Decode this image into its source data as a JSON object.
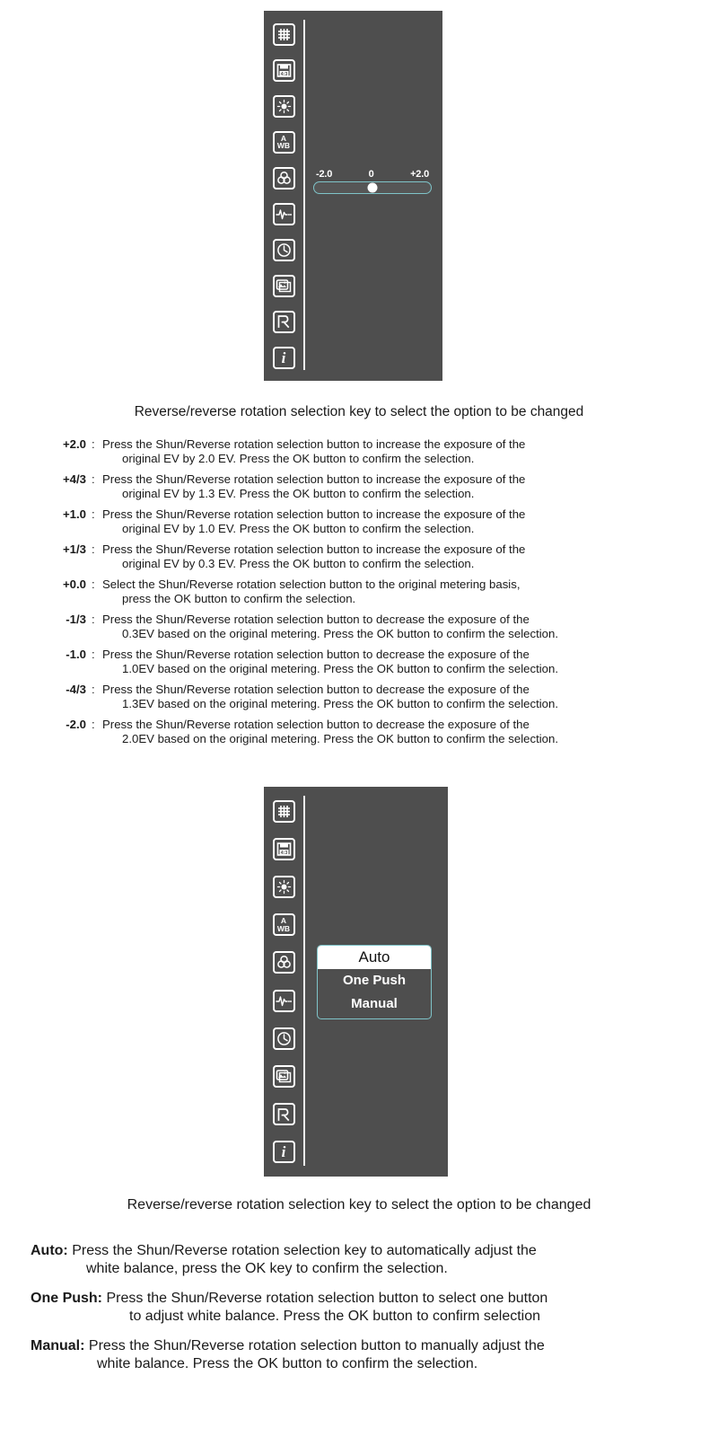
{
  "panel_one": {
    "icons": [
      {
        "name": "grid-icon",
        "label": "grid"
      },
      {
        "name": "aspect-ratio-icon",
        "label": "4:3"
      },
      {
        "name": "brightness-icon",
        "label": "brightness"
      },
      {
        "name": "auto-white-balance-icon",
        "label_top": "A",
        "label_bottom": "WB"
      },
      {
        "name": "color-wheel-icon",
        "label": "color"
      },
      {
        "name": "waveform-icon",
        "label": "waveform"
      },
      {
        "name": "clock-icon",
        "label": "clock"
      },
      {
        "name": "image-stack-icon",
        "label": "image"
      },
      {
        "name": "reset-icon",
        "label": "R"
      },
      {
        "name": "info-icon",
        "label": "i"
      }
    ],
    "slider": {
      "tick_min": "-2.0",
      "tick_mid": "0",
      "tick_max": "+2.0",
      "value": "0",
      "accent_color": "#7fc4c9",
      "knob_color": "#ffffff"
    },
    "panel_bg": "#4e4e4e"
  },
  "panel_two": {
    "icons": [
      {
        "name": "grid-icon",
        "label": "grid"
      },
      {
        "name": "aspect-ratio-icon",
        "label": "4:3"
      },
      {
        "name": "brightness-icon",
        "label": "brightness"
      },
      {
        "name": "auto-white-balance-icon",
        "label_top": "A",
        "label_bottom": "WB"
      },
      {
        "name": "color-wheel-icon",
        "label": "color"
      },
      {
        "name": "waveform-icon",
        "label": "waveform"
      },
      {
        "name": "clock-icon",
        "label": "clock"
      },
      {
        "name": "image-stack-icon",
        "label": "image"
      },
      {
        "name": "reset-icon",
        "label": "R"
      },
      {
        "name": "info-icon",
        "label": "i"
      }
    ],
    "white_balance_menu": {
      "options": [
        "Auto",
        "One Push",
        "Manual"
      ],
      "selected": "Auto",
      "accent_color": "#7fc4c9"
    },
    "panel_bg": "#4e4e4e"
  },
  "caption_one": "Reverse/reverse rotation selection key to select the option to be changed",
  "caption_two": "Reverse/reverse rotation selection key to select the option to be changed",
  "exposure_entries": [
    {
      "key": "+2.0",
      "line1": "Press the Shun/Reverse rotation selection button to increase the exposure of the",
      "line2": "original EV by 2.0 EV. Press the OK button to confirm the selection."
    },
    {
      "key": "+4/3",
      "line1": "Press the Shun/Reverse rotation selection button to increase the exposure of the",
      "line2": "original EV by 1.3 EV. Press the OK button to confirm the selection."
    },
    {
      "key": "+1.0",
      "line1": "Press the Shun/Reverse rotation selection button to increase the exposure of the",
      "line2": "original EV by 1.0 EV. Press the OK button to confirm the selection."
    },
    {
      "key": "+1/3",
      "line1": "Press the Shun/Reverse rotation selection button to increase the exposure of the",
      "line2": "original EV by 0.3 EV. Press the OK button to confirm the selection."
    },
    {
      "key": "+0.0",
      "line1": "Select the Shun/Reverse rotation selection button to the original metering basis,",
      "line2": "press the OK button to confirm the selection."
    },
    {
      "key": "-1/3",
      "line1": "Press the Shun/Reverse rotation selection button to decrease the exposure of the",
      "line2": "0.3EV based on the original metering. Press the OK button to confirm the selection."
    },
    {
      "key": "-1.0",
      "line1": "Press the Shun/Reverse rotation selection button to decrease the exposure of the",
      "line2": "1.0EV based on the original metering. Press the OK button to confirm the selection."
    },
    {
      "key": "-4/3",
      "line1": "Press the Shun/Reverse rotation selection button to decrease the exposure of the",
      "line2": "1.3EV based on the original metering. Press the OK button to confirm the selection."
    },
    {
      "key": "-2.0",
      "line1": "Press the Shun/Reverse rotation selection button to decrease the exposure of the",
      "line2": "2.0EV based on the original metering. Press the OK button to confirm the selection."
    }
  ],
  "separator_colon": ":",
  "white_balance_entries": [
    {
      "term": "Auto:",
      "line1": "Press the Shun/Reverse rotation selection key to automatically adjust the",
      "line2": "white balance, press the OK key to confirm the selection."
    },
    {
      "term": "One Push:",
      "line1": "Press the Shun/Reverse rotation selection button to select one button",
      "line2": "to adjust white balance. Press the OK button to confirm selection"
    },
    {
      "term": "Manual:",
      "line1": "Press the Shun/Reverse rotation selection button to manually adjust the",
      "line2": "white balance. Press the OK button to confirm the selection."
    }
  ]
}
